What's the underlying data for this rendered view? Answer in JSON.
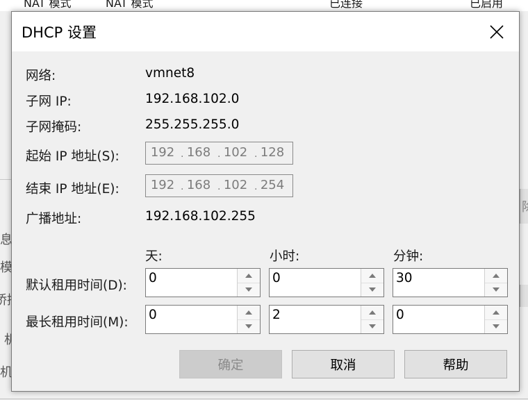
{
  "background": {
    "top_row": [
      "NAT 模式",
      "NAT 模式",
      "已连接",
      "已启用"
    ],
    "side_texts": [
      "息",
      "模",
      "桥接",
      "机",
      "机"
    ],
    "right_text": "除"
  },
  "dialog": {
    "title": "DHCP 设置",
    "close_icon": "close-icon",
    "network_label": "网络:",
    "network_value": "vmnet8",
    "subnet_ip_label": "子网 IP:",
    "subnet_ip_value": "192.168.102.0",
    "subnet_mask_label": "子网掩码:",
    "subnet_mask_value": "255.255.255.0",
    "start_ip_label": "起始 IP 地址(S):",
    "start_ip": [
      "192",
      "168",
      "102",
      "128"
    ],
    "end_ip_label": "结束 IP 地址(E):",
    "end_ip": [
      "192",
      "168",
      "102",
      "254"
    ],
    "broadcast_label": "广播地址:",
    "broadcast_value": "192.168.102.255",
    "col_days": "天:",
    "col_hours": "小时:",
    "col_minutes": "分钟:",
    "default_lease_label": "默认租用时间(D):",
    "default_lease": {
      "days": "0",
      "hours": "0",
      "minutes": "30"
    },
    "max_lease_label": "最长租用时间(M):",
    "max_lease": {
      "days": "0",
      "hours": "2",
      "minutes": "0"
    },
    "ok_label": "确定",
    "cancel_label": "取消",
    "help_label": "帮助"
  }
}
